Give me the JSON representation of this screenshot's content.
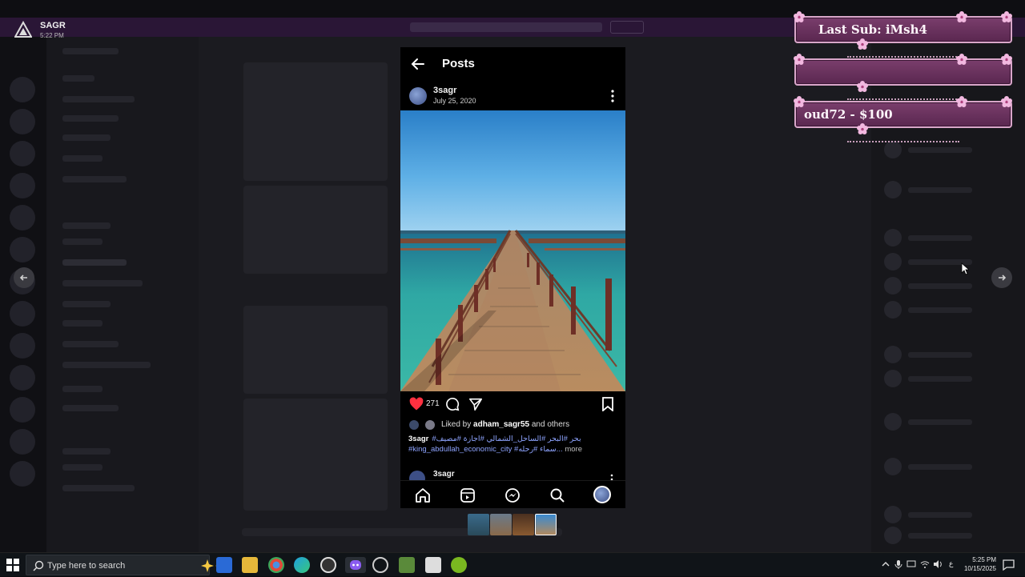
{
  "overlay_badge": {
    "name": "SAGR",
    "time": "5:22 PM"
  },
  "instagram": {
    "header_title": "Posts",
    "post": {
      "username": "3sagr",
      "date": "July 25, 2020",
      "likes_count": "271",
      "liked_by_prefix": "Liked by ",
      "liked_by_user": "adham_sagr55",
      "liked_by_suffix": " and others",
      "caption_user": "3sagr",
      "caption_line1": "بحر #البحر #الساحل_الشمالي #اجازة #مصيف#",
      "caption_line2": "#king_abdullah_economic_city #سماء #رحله...",
      "caption_more": "more"
    },
    "next_post": {
      "username": "3sagr"
    },
    "bottom_nav": [
      "home-icon",
      "reels-icon",
      "messenger-icon",
      "search-icon",
      "profile-avatar"
    ]
  },
  "alerts": {
    "last_sub": "Last Sub: iMsh4",
    "middle": "",
    "donation": "oud72 - $100"
  },
  "taskbar": {
    "search_placeholder": "Type here to search",
    "time": "5:25 PM",
    "date": "10/15/2025",
    "lang": "ع"
  },
  "colors": {
    "accent_link": "#8ea4ff",
    "like_red": "#ff3040",
    "alert_purple": "#6a3060",
    "alert_border": "#d9a6c9"
  }
}
